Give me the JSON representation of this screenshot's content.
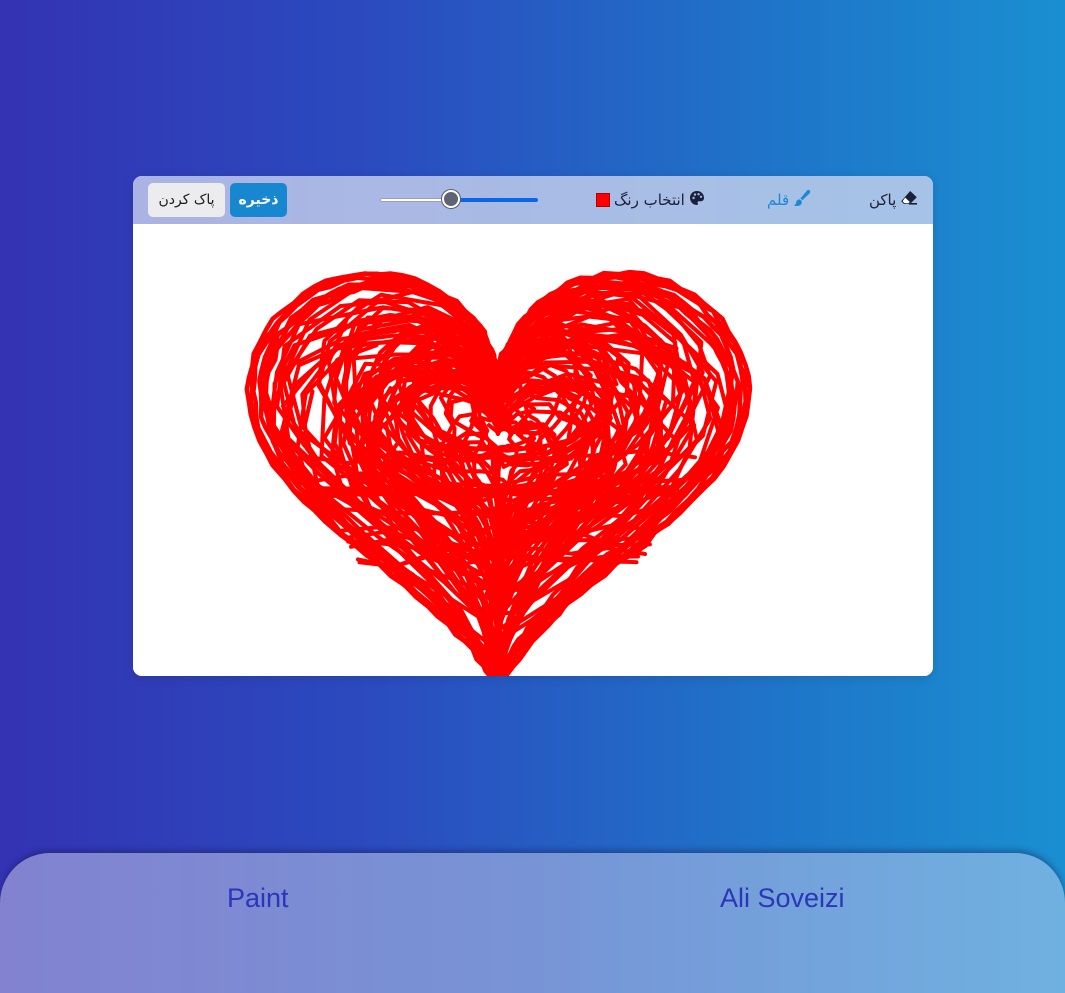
{
  "toolbar": {
    "clear_label": "پاک کردن",
    "save_label": "ذخیره",
    "brush_size": {
      "min": 1,
      "max": 100,
      "value": 45
    },
    "color_picker_label": "انتخاب رنگ",
    "pen_label": "قلم",
    "eraser_label": "پاکن",
    "active_tool": "pen",
    "selected_color": "#ff0000",
    "icons": {
      "color_picker": "palette-icon",
      "pen": "paintbrush-icon",
      "eraser": "eraser-icon"
    }
  },
  "canvas": {
    "stroke_color": "#ff0000",
    "content": "heart-drawing"
  },
  "footer": {
    "left_label": "Paint",
    "right_label": "Ali Soveizi"
  },
  "colors": {
    "accent": "#1788d0",
    "pen_active": "#1e88d4",
    "slider_fill": "#0a66e6"
  }
}
